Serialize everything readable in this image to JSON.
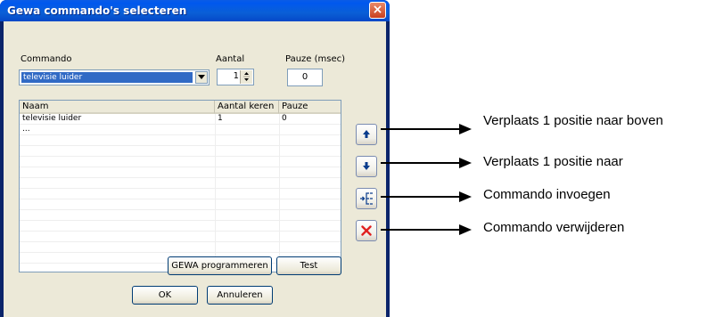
{
  "window": {
    "title": "Gewa commando's selecteren",
    "close_glyph": "×"
  },
  "commando": {
    "label": "Commando",
    "value": "televisie luider",
    "dropdown_icon": "chevron-down-icon"
  },
  "aantal": {
    "label": "Aantal",
    "value": "1"
  },
  "pauze": {
    "label": "Pauze (msec)",
    "value": "0"
  },
  "table": {
    "columns": [
      "Naam",
      "Aantal keren",
      "Pauze"
    ],
    "rows": [
      [
        "televisie luider",
        "1",
        "0"
      ],
      [
        "...",
        "",
        ""
      ]
    ]
  },
  "buttons": {
    "gewa_programmeren": "GEWA programmeren",
    "test": "Test",
    "ok": "OK",
    "annuleren": "Annuleren"
  },
  "side_buttons": [
    {
      "icon": "arrow-up-icon"
    },
    {
      "icon": "arrow-down-icon"
    },
    {
      "icon": "insert-icon"
    },
    {
      "icon": "delete-x-icon"
    }
  ],
  "annotations": [
    "Verplaats 1 positie naar boven",
    "Verplaats 1 positie naar",
    "Commando invoegen",
    "Commando verwijderen"
  ],
  "colors": {
    "title_bar": "#0058ee",
    "selection": "#316ac5",
    "dialog_bg": "#ece9d8",
    "delete_red": "#e02020",
    "arrow_blue": "#0a3c8c"
  }
}
